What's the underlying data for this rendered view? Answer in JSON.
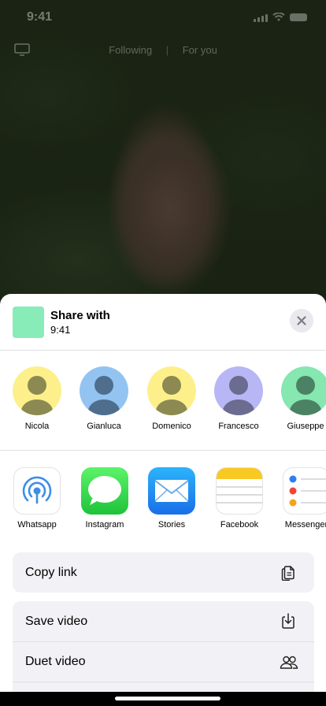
{
  "status": {
    "time": "9:41"
  },
  "feed": {
    "tabs": [
      "Following",
      "For you"
    ]
  },
  "share": {
    "title": "Share with",
    "subtitle": "9:41"
  },
  "contacts": [
    {
      "name": "Nicola",
      "color": "#fdf08b",
      "figure": "#8c8a52"
    },
    {
      "name": "Gianluca",
      "color": "#93c4f1",
      "figure": "#4f6e8e"
    },
    {
      "name": "Domenico",
      "color": "#fdf08b",
      "figure": "#8c8a52"
    },
    {
      "name": "Francesco",
      "color": "#b9b6f5",
      "figure": "#6c6b90"
    },
    {
      "name": "Giuseppe",
      "color": "#86e7b1",
      "figure": "#4c8264"
    }
  ],
  "apps": [
    {
      "name": "Whatsapp",
      "icon": "airdrop-icon"
    },
    {
      "name": "Instagram",
      "icon": "messages-icon"
    },
    {
      "name": "Stories",
      "icon": "mail-icon"
    },
    {
      "name": "Facebook",
      "icon": "notes-icon"
    },
    {
      "name": "Messenger",
      "icon": "reminders-icon"
    }
  ],
  "actions": {
    "copy_link": "Copy link",
    "save_video": "Save video",
    "duet_video": "Duet video"
  }
}
